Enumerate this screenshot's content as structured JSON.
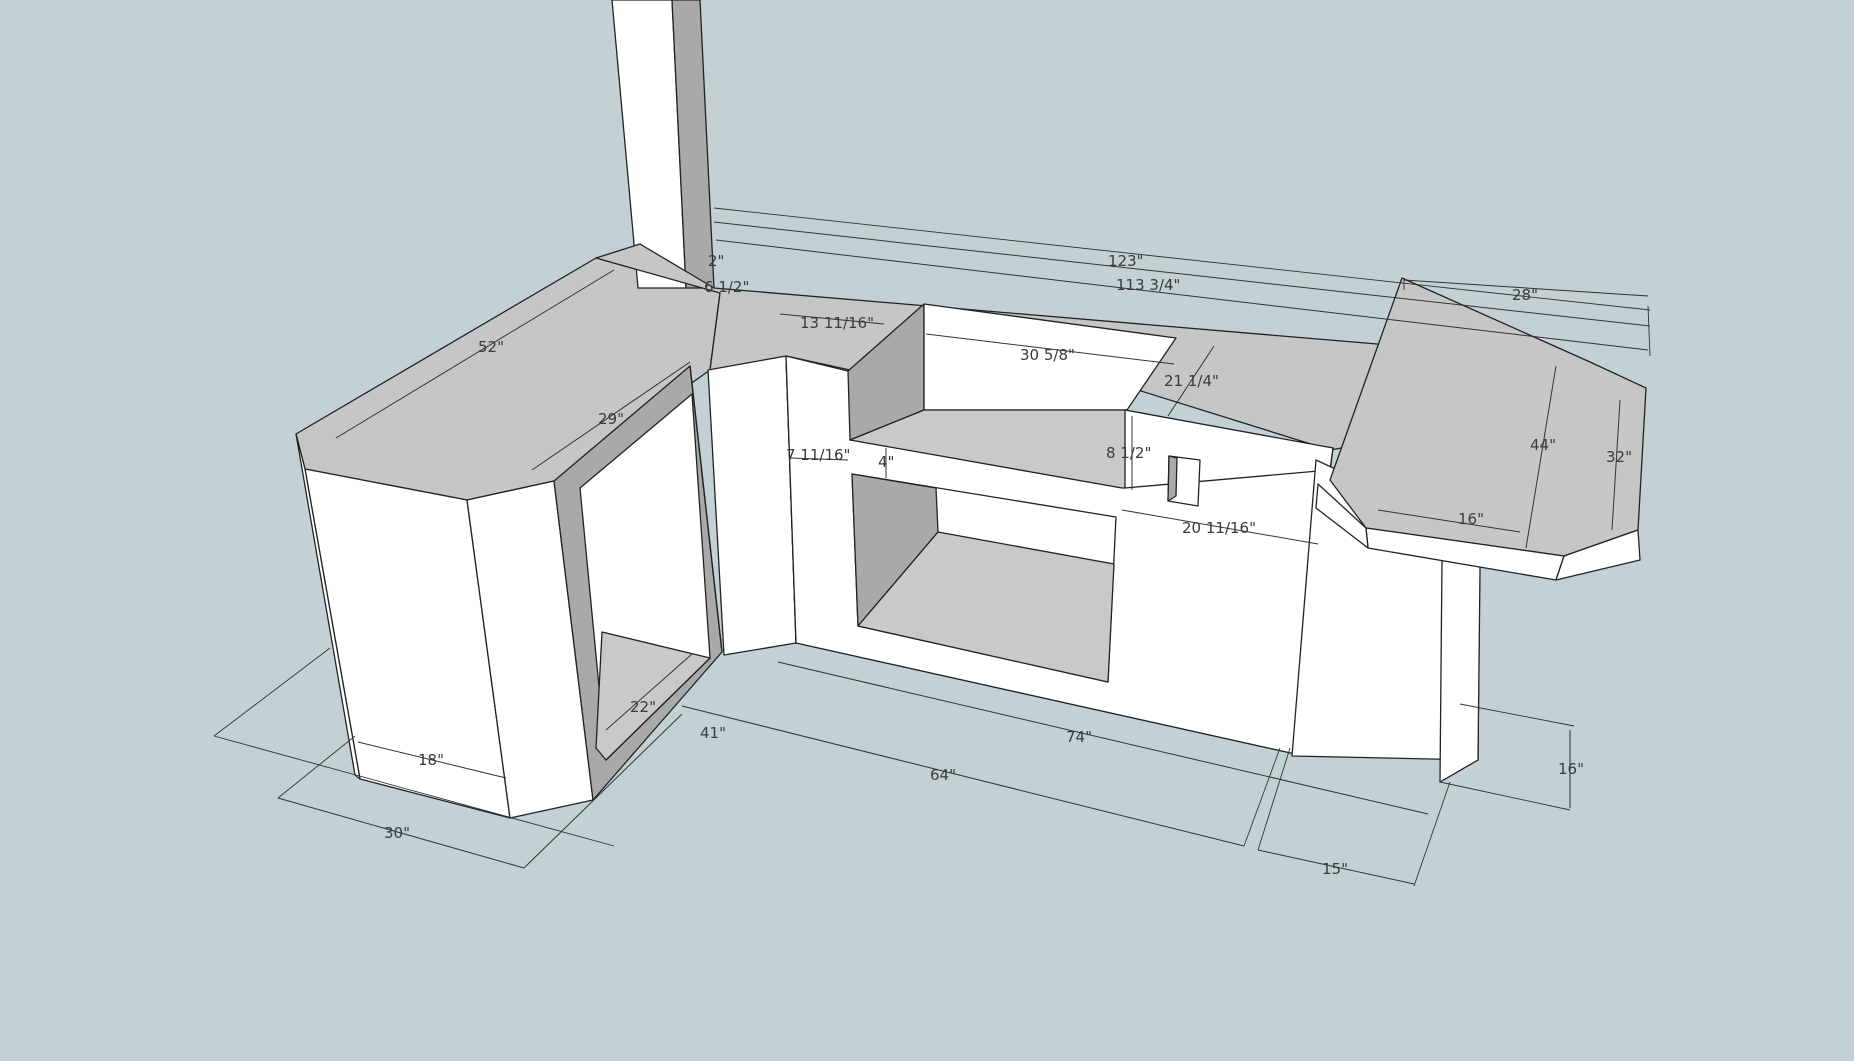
{
  "colors": {
    "background": "#c4d1d4",
    "surface_top": "#c6c6c6",
    "surface_front": "#ffffff",
    "surface_shadow": "#a9a9a9",
    "line": "#222222"
  },
  "dimensions": [
    {
      "id": "d123",
      "label": "123\""
    },
    {
      "id": "d113",
      "label": "113 3/4\""
    },
    {
      "id": "d28",
      "label": "28\""
    },
    {
      "id": "d2",
      "label": "2\""
    },
    {
      "id": "d6half",
      "label": "6 1/2\""
    },
    {
      "id": "d52",
      "label": "52\""
    },
    {
      "id": "d13",
      "label": "13 11/16\""
    },
    {
      "id": "d30_58",
      "label": "30 5/8\""
    },
    {
      "id": "d21",
      "label": "21 1/4\""
    },
    {
      "id": "d29",
      "label": "29\""
    },
    {
      "id": "d7",
      "label": "7 11/16\""
    },
    {
      "id": "d4",
      "label": "4\""
    },
    {
      "id": "d8",
      "label": "8 1/2\""
    },
    {
      "id": "d20",
      "label": "20 11/16\""
    },
    {
      "id": "d44",
      "label": "44\""
    },
    {
      "id": "d32",
      "label": "32\""
    },
    {
      "id": "d16top",
      "label": "16\""
    },
    {
      "id": "d18",
      "label": "18\""
    },
    {
      "id": "d22",
      "label": "22\""
    },
    {
      "id": "d41",
      "label": "41\""
    },
    {
      "id": "d74",
      "label": "74\""
    },
    {
      "id": "d64",
      "label": "64\""
    },
    {
      "id": "d30",
      "label": "30\""
    },
    {
      "id": "d15",
      "label": "15\""
    },
    {
      "id": "d16side",
      "label": "16\""
    }
  ]
}
